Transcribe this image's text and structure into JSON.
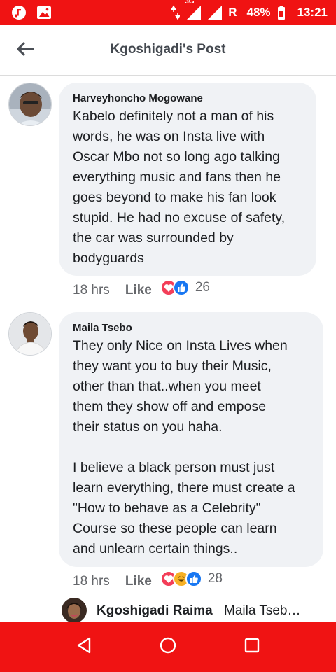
{
  "status_bar": {
    "network": "3G",
    "roaming": "R",
    "battery": "48%",
    "time": "13:21",
    "icons": [
      "music-icon",
      "image-icon",
      "data-arrows-icon",
      "signal-icon",
      "battery-icon"
    ]
  },
  "header": {
    "title": "Kgoshigadi's Post",
    "back_icon": "arrow-left-icon"
  },
  "comments": [
    {
      "author": "Harveyhoncho Mogowane",
      "text": "Kabelo definitely not a man of his\nwords, he was on Insta live with\nOscar Mbo not so long ago talking\neverything music and fans then he\ngoes beyond to make his fan look\nstupid. He had no excuse of safety,\nthe car was surrounded by\nbodyguards",
      "time": "18 hrs",
      "like_label": "Like",
      "reactions": [
        "love",
        "like"
      ],
      "reaction_count": "26"
    },
    {
      "author": "Maila Tsebo",
      "text": "They only Nice on Insta Lives when\nthey want you to buy their Music,\nother than that..when you meet\nthem they show off and empose\ntheir status on you haha.\n\nI believe a black person must just\nlearn everything, there must create a\n\"How to behave as a Celebrity\"\nCourse so these people can learn\nand unlearn certain things..",
      "time": "18 hrs",
      "like_label": "Like",
      "reactions": [
        "love",
        "haha",
        "like"
      ],
      "reaction_count": "28"
    }
  ],
  "reply": {
    "author": "Kgoshigadi Raima",
    "text": "Maila Tseb…"
  },
  "nav_bar": {
    "icons": [
      "back-triangle-icon",
      "home-circle-icon",
      "recents-square-icon"
    ]
  },
  "colors": {
    "system_bar": "#f01313",
    "bubble": "#f0f2f5",
    "love": "#f33e58",
    "like": "#1877f2",
    "haha": "#f7b125"
  }
}
